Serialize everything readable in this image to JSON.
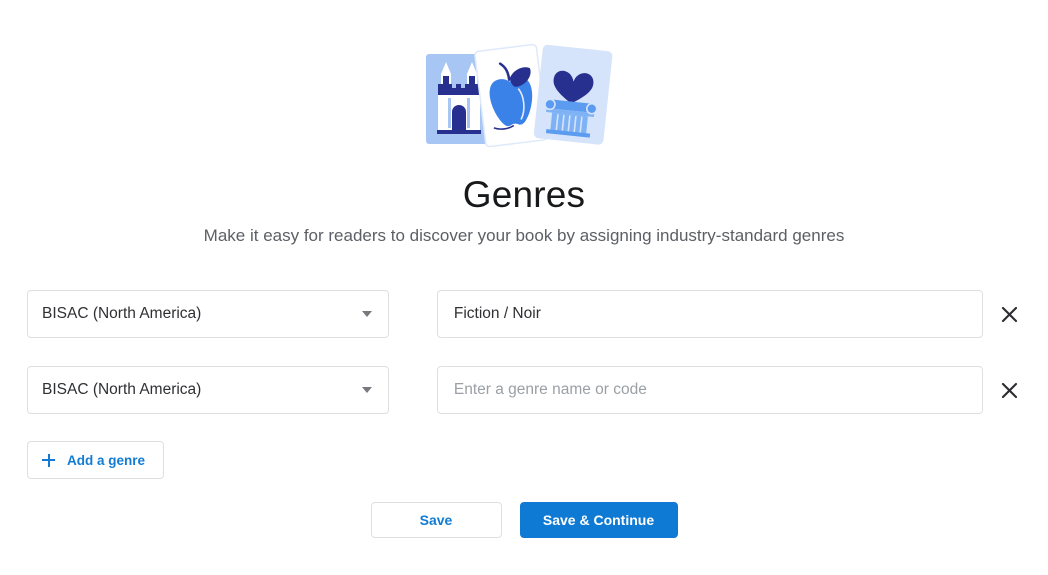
{
  "header": {
    "title": "Genres",
    "subtitle": "Make it easy for readers to discover your book by assigning industry-standard genres",
    "illustration": {
      "name": "genre-cards-illustration",
      "cards": [
        {
          "icon": "castle-icon",
          "card_color": "#a8c6f4",
          "figure_color": "#ffffff",
          "accent_color": "#28308f"
        },
        {
          "icon": "apple-icon",
          "card_color": "#ffffff",
          "figure_color": "#3b82e8",
          "accent_color": "#28308f"
        },
        {
          "icon": "column-heart-icon",
          "card_color": "#d6e4fb",
          "figure_color": "#5b9bf0",
          "accent_color": "#28308f"
        }
      ]
    }
  },
  "genre_rows": [
    {
      "scheme_label": "BISAC (North America)",
      "genre_value": "Fiction / Noir",
      "genre_placeholder": "Enter a genre name or code",
      "remove_icon": "close-icon"
    },
    {
      "scheme_label": "BISAC (North America)",
      "genre_value": "",
      "genre_placeholder": "Enter a genre name or code",
      "remove_icon": "close-icon"
    }
  ],
  "add_genre": {
    "label": "Add a genre",
    "icon": "plus-icon"
  },
  "footer": {
    "save_label": "Save",
    "save_continue_label": "Save & Continue"
  },
  "colors": {
    "primary_blue": "#0f7ad4",
    "link_blue": "#127cd4",
    "border_gray": "#dedfe1",
    "text_dark": "#18191b",
    "text_muted": "#5c6066",
    "placeholder_gray": "#9aa0a6"
  }
}
